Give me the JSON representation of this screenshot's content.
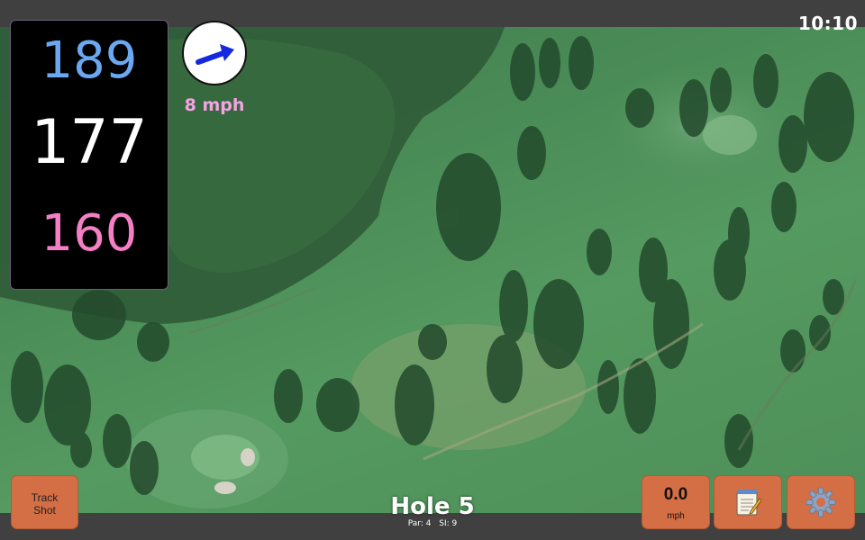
{
  "status": {
    "time": "10:10"
  },
  "distances": {
    "back": "189",
    "center": "177",
    "front": "160"
  },
  "wind": {
    "speed_label": "8 mph",
    "direction_icon": "wind-arrow-icon"
  },
  "buttons": {
    "track_shot": {
      "line1": "Track",
      "line2": "Shot"
    },
    "wind": {
      "value": "0.0",
      "unit": "mph"
    },
    "notes_icon": "notepad-icon",
    "settings_icon": "gear-icon"
  },
  "hole": {
    "title": "Hole 5",
    "par": "Par: 4",
    "si": "SI: 9"
  },
  "colors": {
    "back_distance": "#6aa9f2",
    "center_distance": "#ffffff",
    "front_distance": "#f57fc5",
    "button": "#d36e45",
    "wind_label": "#f6a2e4"
  }
}
